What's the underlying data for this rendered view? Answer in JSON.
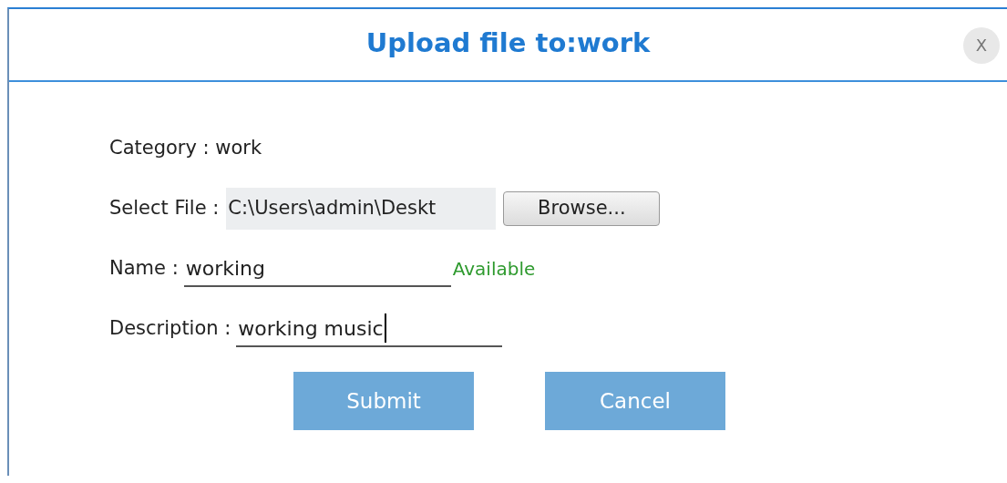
{
  "dialog": {
    "title": "Upload file to:work",
    "close": "X"
  },
  "fields": [
    {
      "kind": "static",
      "label": "Category :",
      "value": "work"
    },
    {
      "kind": "file",
      "label": "Select File :",
      "value": "C:\\Users\\admin\\Deskt",
      "button": "Browse..."
    },
    {
      "kind": "text",
      "label": "Name :",
      "value": "working",
      "status": "Available"
    },
    {
      "kind": "text",
      "label": "Description :",
      "value": "working music",
      "focused": true
    }
  ],
  "buttons": [
    "Submit",
    "Cancel"
  ]
}
